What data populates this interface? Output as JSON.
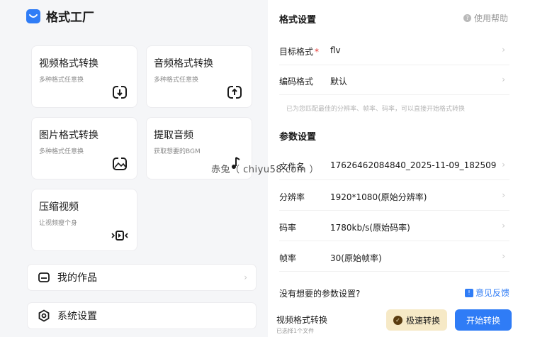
{
  "app": {
    "title": "格式工厂"
  },
  "cards": [
    {
      "title": "视频格式转换",
      "subtitle": "多种格式任意换",
      "icon": "convert-icon"
    },
    {
      "title": "音频格式转换",
      "subtitle": "多种格式任意换",
      "icon": "convert-icon"
    },
    {
      "title": "图片格式转换",
      "subtitle": "多种格式任意换",
      "icon": "image-convert-icon"
    },
    {
      "title": "提取音频",
      "subtitle": "获取想要的BGM",
      "icon": "extract-audio-icon"
    },
    {
      "title": "压缩视频",
      "subtitle": "让视频瘦个身",
      "icon": "compress-icon"
    }
  ],
  "menu": [
    {
      "label": "我的作品",
      "icon": "works-icon"
    },
    {
      "label": "系统设置",
      "icon": "settings-icon"
    }
  ],
  "format_settings": {
    "title": "格式设置",
    "help_label": "使用帮助",
    "target_format_label": "目标格式",
    "target_format_value": "flv",
    "encoding_label": "编码格式",
    "encoding_value": "默认",
    "hint": "已为您匹配最佳的分辨率、帧率、码率，可以直接开始格式转换"
  },
  "param_settings": {
    "title": "参数设置",
    "rows": [
      {
        "label": "文件名",
        "value": "17626462084840_2025-11-09_182509"
      },
      {
        "label": "分辨率",
        "value": "1920*1080(原始分辨率)"
      },
      {
        "label": "码率",
        "value": "1780kb/s(原始码率)"
      },
      {
        "label": "帧率",
        "value": "30(原始帧率)"
      }
    ]
  },
  "footer": {
    "question": "没有想要的参数设置?",
    "feedback": "意见反馈",
    "task_label": "视频格式转换",
    "task_sub": "已选择1个文件",
    "fast_button": "极速转换",
    "start_button": "开始转换"
  },
  "watermark": "赤兔（ chiyu58.com ）",
  "colors": {
    "accent": "#2f7cf6",
    "fast_bg": "#f6e9c6",
    "required": "#e53935"
  }
}
